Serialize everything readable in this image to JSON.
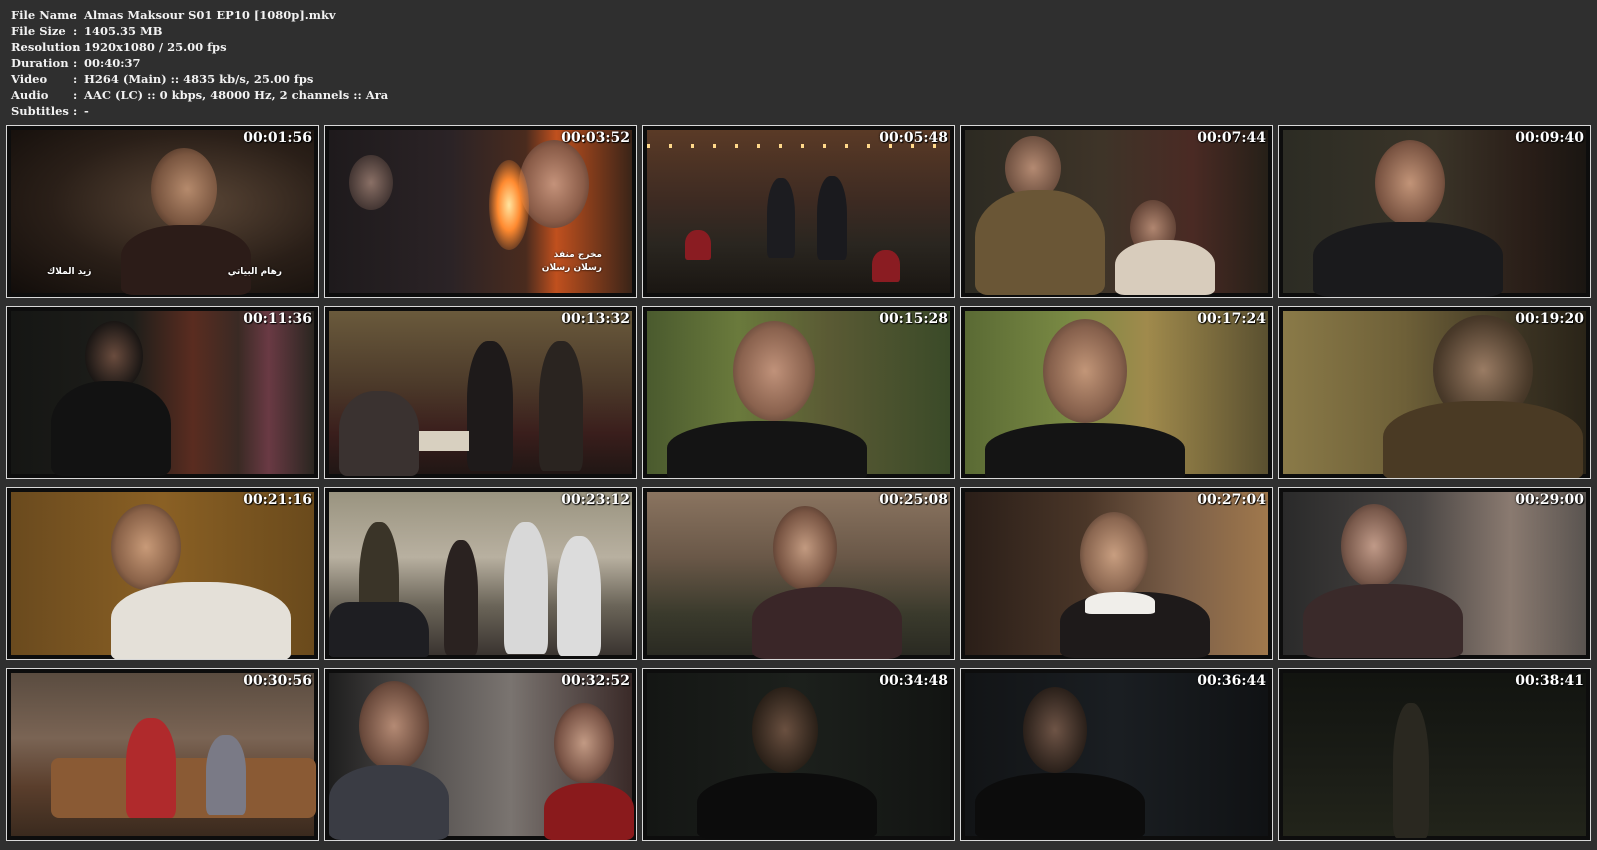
{
  "media_info": {
    "rows": [
      {
        "label": "File Name",
        "sep": ":",
        "value": "Almas Maksour S01 EP10 [1080p].mkv"
      },
      {
        "label": "File Size",
        "sep": ":",
        "value": "1405.35 MB"
      },
      {
        "label": "Resolution",
        "sep": ":",
        "value": "1920x1080 / 25.00 fps"
      },
      {
        "label": "Duration",
        "sep": ":",
        "value": "00:40:37"
      },
      {
        "label": "Video",
        "sep": ":",
        "value": "H264 (Main) :: 4835 kb/s, 25.00 fps"
      },
      {
        "label": "Audio",
        "sep": ":",
        "value": "AAC (LC) :: 0 kbps, 48000 Hz, 2 channels :: Ara"
      },
      {
        "label": "Subtitles",
        "sep": ":",
        "value": "-"
      }
    ]
  },
  "thumbnails": [
    {
      "time": "00:01:56"
    },
    {
      "time": "00:03:52"
    },
    {
      "time": "00:05:48"
    },
    {
      "time": "00:07:44"
    },
    {
      "time": "00:09:40"
    },
    {
      "time": "00:11:36"
    },
    {
      "time": "00:13:32"
    },
    {
      "time": "00:15:28"
    },
    {
      "time": "00:17:24"
    },
    {
      "time": "00:19:20"
    },
    {
      "time": "00:21:16"
    },
    {
      "time": "00:23:12"
    },
    {
      "time": "00:25:08"
    },
    {
      "time": "00:27:04"
    },
    {
      "time": "00:29:00"
    },
    {
      "time": "00:30:56"
    },
    {
      "time": "00:32:52"
    },
    {
      "time": "00:34:48"
    },
    {
      "time": "00:36:44"
    },
    {
      "time": "00:38:41"
    }
  ],
  "captions": {
    "thumb1_left": "زيد الملاك",
    "thumb1_right": "رهام البياتي",
    "thumb2_line1": "مخرج منفذ",
    "thumb2_line2": "رسلان رسلان"
  }
}
